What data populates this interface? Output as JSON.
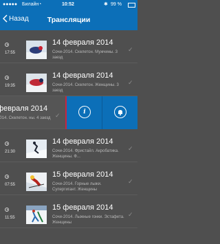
{
  "status": {
    "carrier": "Билайн",
    "time": "10:52",
    "battery": "99 %"
  },
  "nav": {
    "back_label": "Назад",
    "title": "Трансляции"
  },
  "rows": [
    {
      "time": "17:55",
      "date": "14 февраля 2014",
      "desc": "Сочи-2014. Скелетон. Мужчины. 3 заезд"
    },
    {
      "time": "19:35",
      "date": "14 февраля 2014",
      "desc": "Сочи-2014. Скелетон. Женщины. 3 заезд"
    },
    {
      "time": "",
      "date": "февраля 2014",
      "desc": "2014. Скелетон. ны. 4 заезд"
    },
    {
      "time": "21:30",
      "date": "14 февраля 2014",
      "desc": "Сочи-2014. Фристайл. Акробатика. Женщины. Ф..."
    },
    {
      "time": "07:55",
      "date": "15 февраля 2014",
      "desc": "Сочи-2014. Горные лыжи. Супергигант. Женщины"
    },
    {
      "time": "11:55",
      "date": "15 февраля 2014",
      "desc": "Сочи-2014. Лыжные гонки. Эстафета. Женщины"
    }
  ],
  "icons": {
    "info": "info-icon",
    "bell": "bell-icon",
    "check": "check-icon",
    "clock": "clock-icon"
  },
  "colors": {
    "accent": "#0c6fb8",
    "swipe_edge": "#c9243f"
  }
}
